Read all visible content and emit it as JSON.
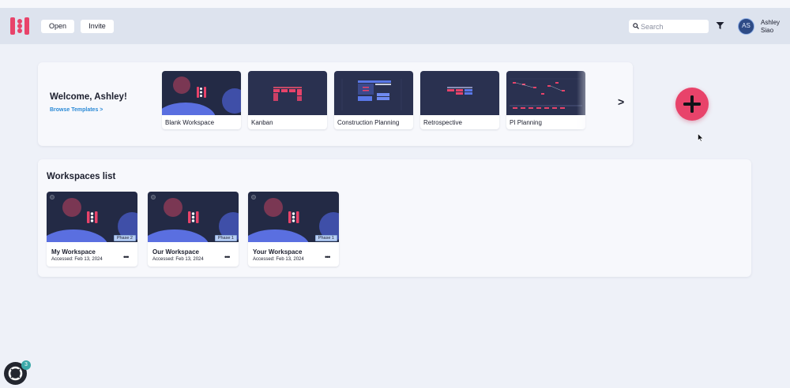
{
  "header": {
    "open_label": "Open",
    "invite_label": "Invite",
    "search_placeholder": "Search",
    "avatar_initials": "AS",
    "user_first": "Ashley",
    "user_last": "Siao"
  },
  "welcome": {
    "title": "Welcome, Ashley!",
    "browse_link": "Browse Templates >",
    "next_arrow": ">"
  },
  "templates": [
    {
      "label": "Blank Workspace",
      "icon": "blank-workspace-thumbnail"
    },
    {
      "label": "Kanban",
      "icon": "kanban-thumbnail"
    },
    {
      "label": "Construction Planning",
      "icon": "construction-planning-thumbnail"
    },
    {
      "label": "Retrospective",
      "icon": "retrospective-thumbnail"
    },
    {
      "label": "PI Planning",
      "icon": "pi-planning-thumbnail"
    }
  ],
  "workspaces": {
    "title": "Workspaces list",
    "items": [
      {
        "name": "My Workspace",
        "accessed": "Accessed: Feb 13, 2024",
        "phase": "Phase 2",
        "more": "•••"
      },
      {
        "name": "Our Workspace",
        "accessed": "Accessed: Feb 13, 2024",
        "phase": "Phase 1",
        "more": "•••"
      },
      {
        "name": "Your Workspace",
        "accessed": "Accessed: Feb 13, 2024",
        "phase": "Phase 1",
        "more": "•••"
      }
    ]
  },
  "help_widget": {
    "badge_count": "3"
  },
  "colors": {
    "background": "#eef1f8",
    "header": "#dde3ee",
    "brand_red": "#e8436a",
    "link_blue": "#2b8ad6",
    "thumb_dark": "#232a45"
  }
}
